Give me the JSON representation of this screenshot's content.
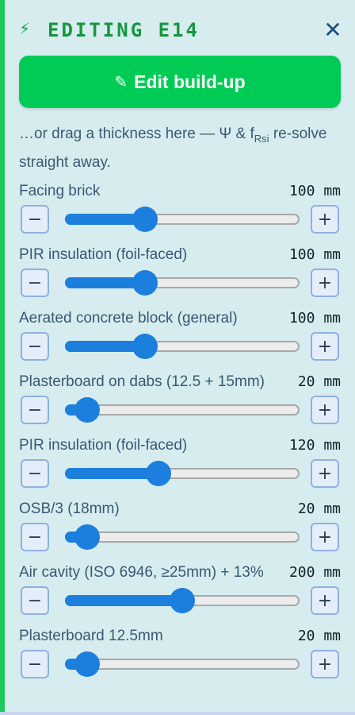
{
  "header": {
    "icon": "lightning-bolt-icon",
    "title": "EDITING E14",
    "close_icon": "close-icon"
  },
  "edit_button": {
    "icon": "pencil-icon",
    "label": "Edit build-up"
  },
  "hint": {
    "before": "…or drag a thickness here — Ψ & f",
    "subscript": "Rsi",
    "after": " re-solve straight away."
  },
  "stepper": {
    "minus": "−",
    "plus": "+"
  },
  "colors": {
    "accent_green": "#00cc55",
    "slider_blue": "#1d7fdd",
    "panel_bg": "#d6ecef"
  },
  "layers": [
    {
      "name": "Facing brick",
      "value": "100 mm",
      "fraction": 0.34
    },
    {
      "name": "PIR insulation (foil-faced)",
      "value": "100 mm",
      "fraction": 0.34
    },
    {
      "name": "Aerated concrete block (general)",
      "value": "100 mm",
      "fraction": 0.34
    },
    {
      "name": "Plasterboard on dabs (12.5 + 15mm)",
      "value": "20 mm",
      "fraction": 0.095
    },
    {
      "name": "PIR insulation (foil-faced)",
      "value": "120 mm",
      "fraction": 0.4
    },
    {
      "name": "OSB/3 (18mm)",
      "value": "20 mm",
      "fraction": 0.095
    },
    {
      "name": "Air cavity (ISO 6946, ≥25mm) + 13%",
      "value": "200 mm",
      "fraction": 0.5
    },
    {
      "name": "Plasterboard 12.5mm",
      "value": "20 mm",
      "fraction": 0.095
    }
  ]
}
